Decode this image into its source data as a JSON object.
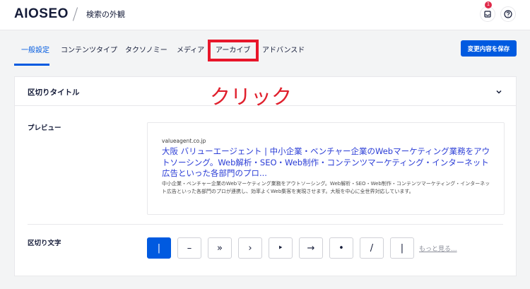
{
  "header": {
    "logo": "AIOSEO",
    "breadcrumb": "検索の外観",
    "notification_count": "1"
  },
  "tabs": [
    {
      "label": "一般設定",
      "active": true
    },
    {
      "label": "コンテンツタイプ",
      "active": false
    },
    {
      "label": "タクソノミー",
      "active": false
    },
    {
      "label": "メディア",
      "active": false
    },
    {
      "label": "アーカイブ",
      "active": false
    },
    {
      "label": "アドバンスド",
      "active": false
    }
  ],
  "save_button": "変更内容を保存",
  "annotation": "クリック",
  "section": {
    "title": "区切りタイトル",
    "preview_label": "プレビュー",
    "preview": {
      "domain": "valueagent.co.jp",
      "title": "大阪 バリューエージェント | 中小企業・ベンチャー企業のWebマーケティング業務をアウトソーシング。Web解析・SEO・Web制作・コンテンツマーケティング・インターネット広告といった各部門のプロ...",
      "description": "中小企業・ベンチャー企業のWebマーケティング業務をアウトソーシング。Web解析・SEO・Web制作・コンテンツマーケティング・インターネット広告といった各部門のプロが連携し、効率よくWeb集客を実現させます。大阪を中心に全世界対応しています。"
    },
    "separator_label": "区切り文字",
    "separators": [
      "|",
      "–",
      "»",
      "›",
      "‣",
      "→",
      "•",
      "/",
      "|"
    ],
    "selected_separator_index": 0,
    "more_link": "もっと見る..."
  },
  "colors": {
    "accent": "#005ae0",
    "annotation": "#e0202d",
    "link": "#2a3cd6"
  }
}
